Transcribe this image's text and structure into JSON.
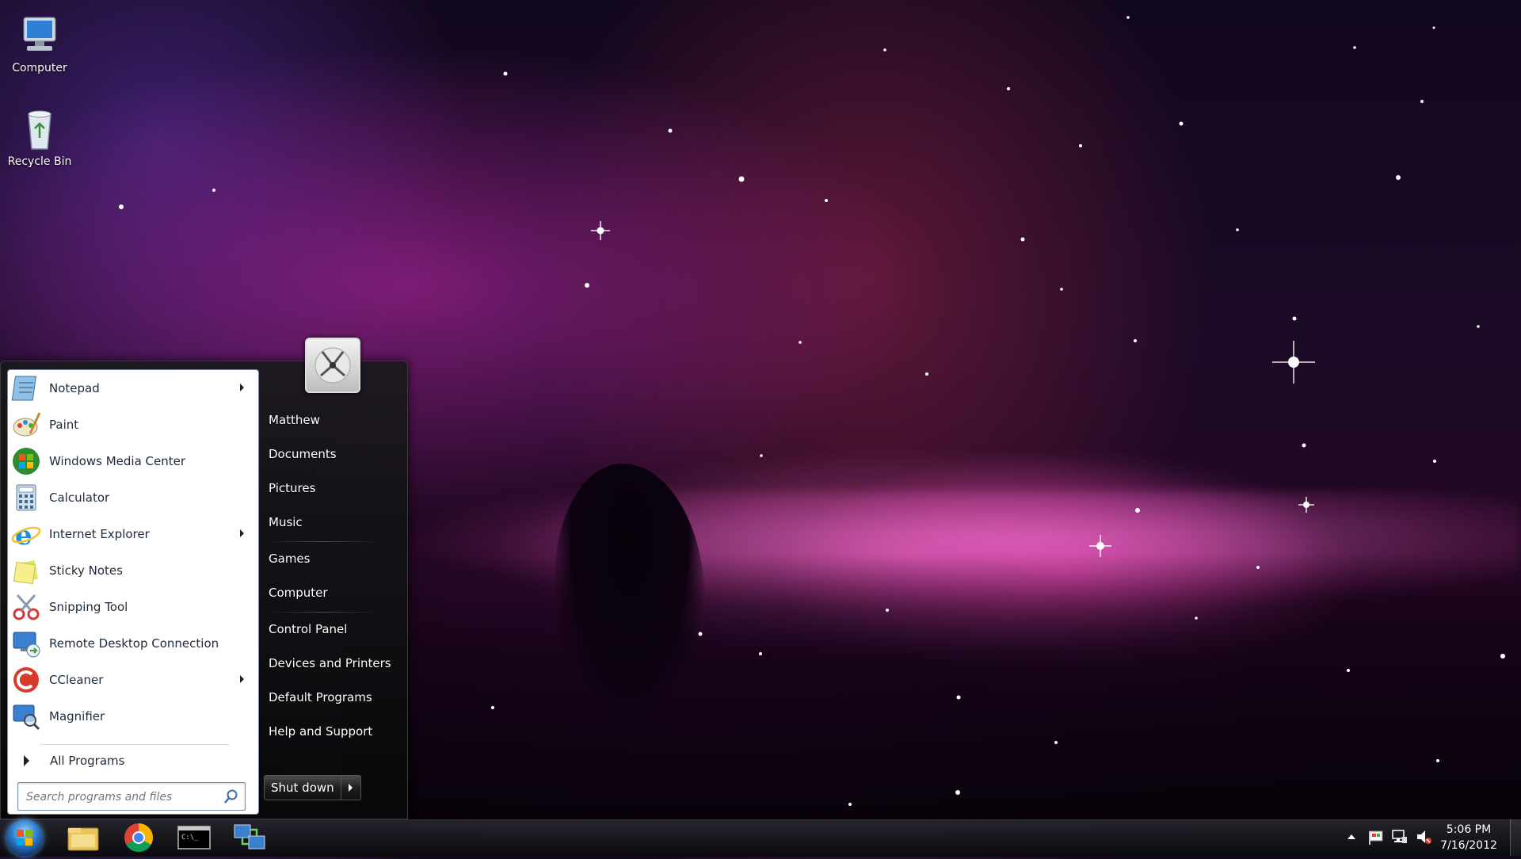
{
  "desktop": {
    "icons": [
      {
        "label": "Computer"
      },
      {
        "label": "Recycle Bin"
      }
    ]
  },
  "start_menu": {
    "programs": [
      {
        "label": "Notepad",
        "icon": "notepad-icon",
        "has_submenu": true
      },
      {
        "label": "Paint",
        "icon": "paint-icon",
        "has_submenu": false
      },
      {
        "label": "Windows Media Center",
        "icon": "media-center-icon",
        "has_submenu": false
      },
      {
        "label": "Calculator",
        "icon": "calculator-icon",
        "has_submenu": false
      },
      {
        "label": "Internet Explorer",
        "icon": "internet-explorer-icon",
        "has_submenu": true
      },
      {
        "label": "Sticky Notes",
        "icon": "sticky-notes-icon",
        "has_submenu": false
      },
      {
        "label": "Snipping Tool",
        "icon": "scissors-icon",
        "has_submenu": false
      },
      {
        "label": "Remote Desktop Connection",
        "icon": "remote-desktop-icon",
        "has_submenu": false
      },
      {
        "label": "CCleaner",
        "icon": "ccleaner-icon",
        "has_submenu": true
      },
      {
        "label": "Magnifier",
        "icon": "magnifier-icon",
        "has_submenu": false
      }
    ],
    "all_programs_label": "All Programs",
    "search_placeholder": "Search programs and files",
    "right_items": [
      "Matthew",
      "Documents",
      "Pictures",
      "Music",
      "Games",
      "Computer",
      "Control Panel",
      "Devices and Printers",
      "Default Programs",
      "Help and Support"
    ],
    "shutdown_label": "Shut down"
  },
  "taskbar": {
    "pinned": [
      "windows-explorer-icon",
      "chrome-icon",
      "command-prompt-icon",
      "network-app-icon"
    ],
    "clock": {
      "time": "5:06 PM",
      "date": "7/16/2012"
    }
  },
  "colors": {
    "menu_bg": "#111114",
    "accent_blue": "#2a78c8",
    "nebula_pink": "#ff5ac8"
  }
}
